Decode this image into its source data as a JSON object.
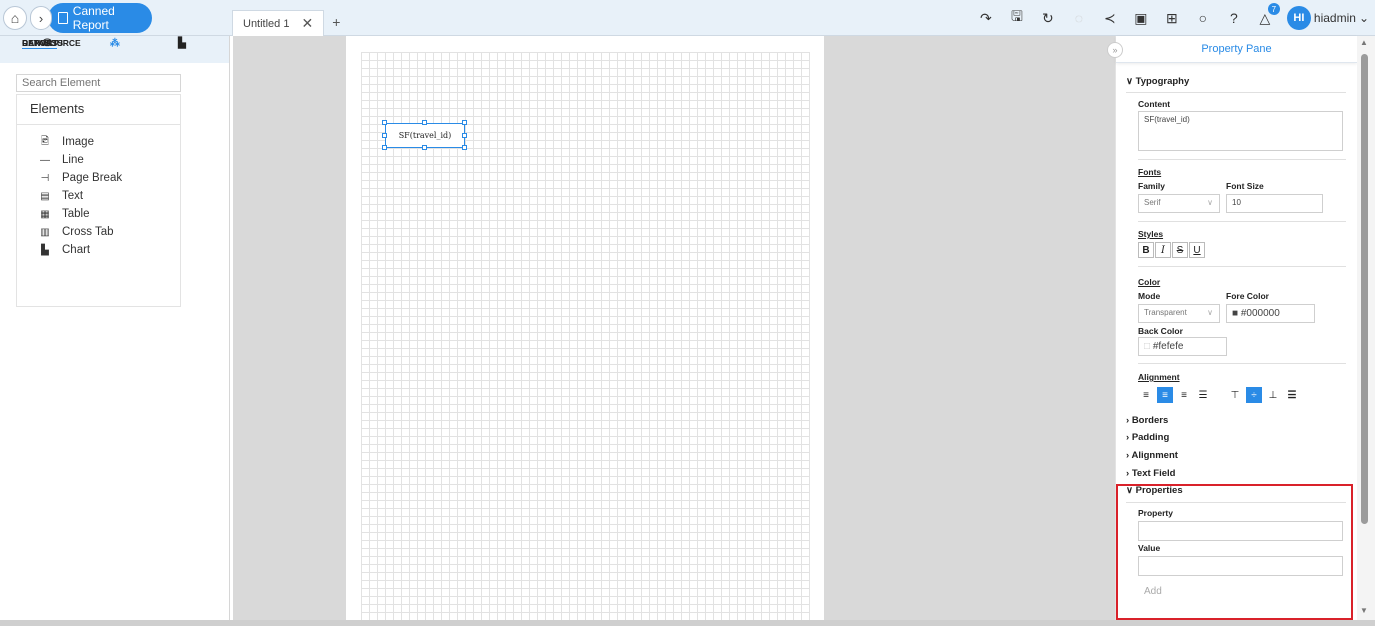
{
  "topbar": {
    "breadcrumb_label": "Canned Report",
    "tab_label": "Untitled 1",
    "tab_close": "✕",
    "tab_add": "+",
    "user_initials": "HI",
    "user_name": "hiadmin",
    "notification_count": "7"
  },
  "left": {
    "tabs": [
      {
        "label": "DATASOURCE",
        "icon": "database-icon"
      },
      {
        "label": "CANVAS",
        "icon": "canvas-icon"
      },
      {
        "label": "REPORTS",
        "icon": "chart-icon"
      }
    ],
    "search_placeholder": "Search Element",
    "elements_title": "Elements",
    "elements": [
      {
        "label": "Image",
        "icon": "image-icon"
      },
      {
        "label": "Line",
        "icon": "line-icon"
      },
      {
        "label": "Page Break",
        "icon": "page-break-icon"
      },
      {
        "label": "Text",
        "icon": "text-icon"
      },
      {
        "label": "Table",
        "icon": "table-icon"
      },
      {
        "label": "Cross Tab",
        "icon": "cross-tab-icon"
      },
      {
        "label": "Chart",
        "icon": "chart-icon"
      }
    ]
  },
  "canvas": {
    "selected_text": "SF(travel_id)"
  },
  "pane": {
    "title": "Property Pane",
    "typography": "Typography",
    "content_label": "Content",
    "content_value": "SF(travel_id)",
    "fonts_label": "Fonts",
    "family_label": "Family",
    "family_value": "Serif",
    "font_size_label": "Font Size",
    "font_size_value": "10",
    "styles_label": "Styles",
    "color_label": "Color",
    "mode_label": "Mode",
    "mode_value": "Transparent",
    "fore_color_label": "Fore Color",
    "fore_color_value": "#000000",
    "back_color_label": "Back Color",
    "back_color_value": "#fefefe",
    "alignment_label": "Alignment",
    "collapsed_sections": [
      "Borders",
      "Padding",
      "Alignment",
      "Text Field"
    ],
    "properties_label": "Properties",
    "property_label": "Property",
    "value_label": "Value",
    "add_label": "Add"
  },
  "colors": {
    "accent": "#2a8be6",
    "highlight_border": "#d9212a"
  }
}
